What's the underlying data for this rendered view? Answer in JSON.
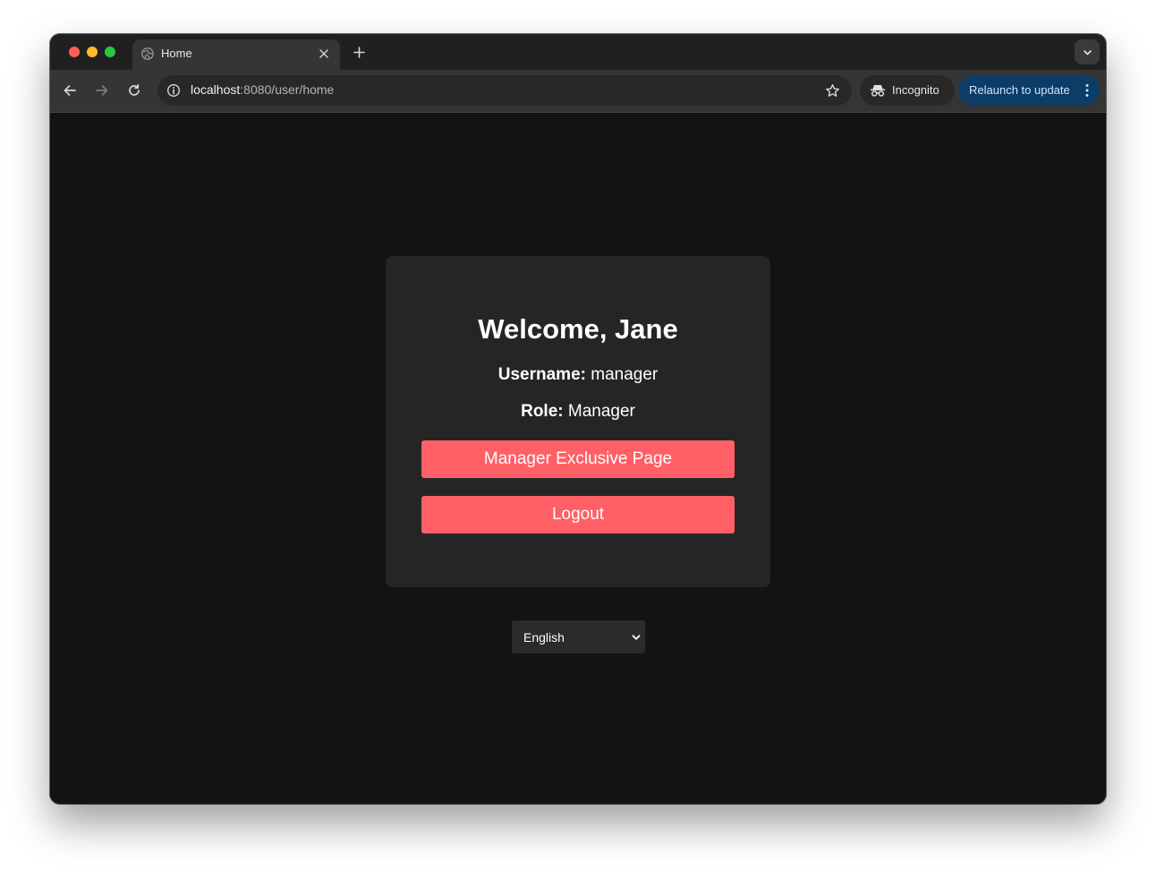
{
  "browser": {
    "tab": {
      "title": "Home"
    },
    "url": {
      "host": "localhost",
      "rest": ":8080/user/home"
    },
    "incognito_label": "Incognito",
    "relaunch_label": "Relaunch to update"
  },
  "page": {
    "welcome": "Welcome, Jane",
    "username": {
      "label": "Username:",
      "value": "manager"
    },
    "role": {
      "label": "Role:",
      "value": "Manager"
    },
    "buttons": {
      "manager_page": "Manager Exclusive Page",
      "logout": "Logout"
    },
    "language": {
      "selected": "English"
    }
  },
  "colors": {
    "accent_button": "#ff5f65",
    "page_background": "#131313",
    "card_background": "#252525",
    "relaunch_background": "#0c3d66"
  }
}
